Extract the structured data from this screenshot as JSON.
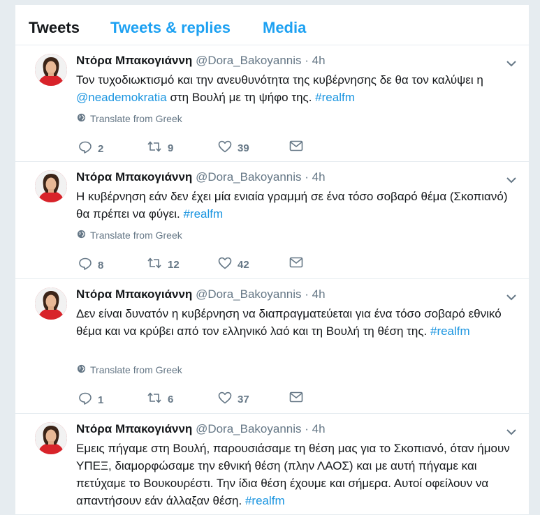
{
  "tabs": [
    {
      "label": "Tweets",
      "active": true
    },
    {
      "label": "Tweets & replies",
      "active": false
    },
    {
      "label": "Media",
      "active": false
    }
  ],
  "colors": {
    "link": "#1b95e0",
    "tab_inactive": "#1da1f2",
    "muted": "#657786"
  },
  "tweets": [
    {
      "name": "Ντόρα Μπακογιάννη",
      "handle": "@Dora_Bakoyannis",
      "time": "· 4h",
      "text_parts": [
        {
          "text": "Τον τυχοδιωκτισμό και την ανευθυνότητα της κυβέρνησης δε θα τον καλύψει η ",
          "link": false
        },
        {
          "text": "@neademokratia",
          "link": true
        },
        {
          "text": " στη Βουλή με τη ψήφο της.  ",
          "link": false
        },
        {
          "text": "#realfm",
          "link": true
        }
      ],
      "translate": "Translate from Greek",
      "replies": "2",
      "retweets": "9",
      "likes": "39"
    },
    {
      "name": "Ντόρα Μπακογιάννη",
      "handle": "@Dora_Bakoyannis",
      "time": "· 4h",
      "text_parts": [
        {
          "text": "Η κυβέρνηση εάν δεν έχει μία ενιαία γραμμή σε ένα τόσο σοβαρό θέμα (Σκοπιανό) θα πρέπει να φύγει. ",
          "link": false
        },
        {
          "text": "#realfm",
          "link": true
        }
      ],
      "translate": "Translate from Greek",
      "replies": "8",
      "retweets": "12",
      "likes": "42"
    },
    {
      "name": "Ντόρα Μπακογιάννη",
      "handle": "@Dora_Bakoyannis",
      "time": "· 4h",
      "text_parts": [
        {
          "text": "Δεν είναι δυνατόν η κυβέρνηση να διαπραγματεύεται για ένα τόσο σοβαρό εθνικό θέμα και να κρύβει από τον ελληνικό λαό και τη Βουλή τη θέση της. ",
          "link": false
        },
        {
          "text": "#realfm",
          "link": true
        }
      ],
      "translate": "Translate from Greek",
      "replies": "1",
      "retweets": "6",
      "likes": "37"
    },
    {
      "name": "Ντόρα Μπακογιάννη",
      "handle": "@Dora_Bakoyannis",
      "time": "· 4h",
      "text_parts": [
        {
          "text": "Εμεις πήγαμε στη Βουλή, παρουσιάσαμε τη θέση μας για το Σκοπιανό,  όταν ήμουν ΥΠΕΞ, διαμορφώσαμε την εθνική θέση (πλην ΛΑΟΣ) και με αυτή πήγαμε και πετύχαμε το Βουκουρέστι. Την ίδια θέση έχουμε και σήμερα.  Αυτοί οφείλουν να απαντήσουν εάν άλλαξαν θέση. ",
          "link": false
        },
        {
          "text": "#realfm",
          "link": true
        }
      ]
    }
  ]
}
